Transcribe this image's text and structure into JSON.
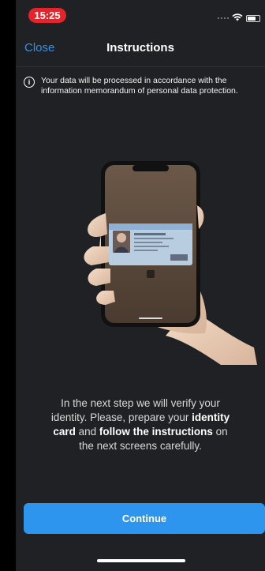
{
  "status_bar": {
    "time": "15:25",
    "icons": [
      "cellular-signal-icon",
      "wifi-icon",
      "battery-icon"
    ]
  },
  "nav": {
    "close_label": "Close",
    "title": "Instructions"
  },
  "info": {
    "icon": "info-icon",
    "text": "Your data will be processed in accordance with the information memorandum of personal data protection."
  },
  "illustration": {
    "icon": "hand-holding-phone-with-id-card"
  },
  "body": {
    "part1": "In the next step we will verify your identity. Please, prepare your ",
    "bold1": "identity card",
    "part2": " and ",
    "bold2": "follow the instructions",
    "part3": " on the next screens carefully."
  },
  "continue_label": "Continue",
  "colors": {
    "background": "#1f2124",
    "accent": "#2e95ef",
    "link": "#3b8fe0",
    "time_pill": "#e2242c"
  }
}
